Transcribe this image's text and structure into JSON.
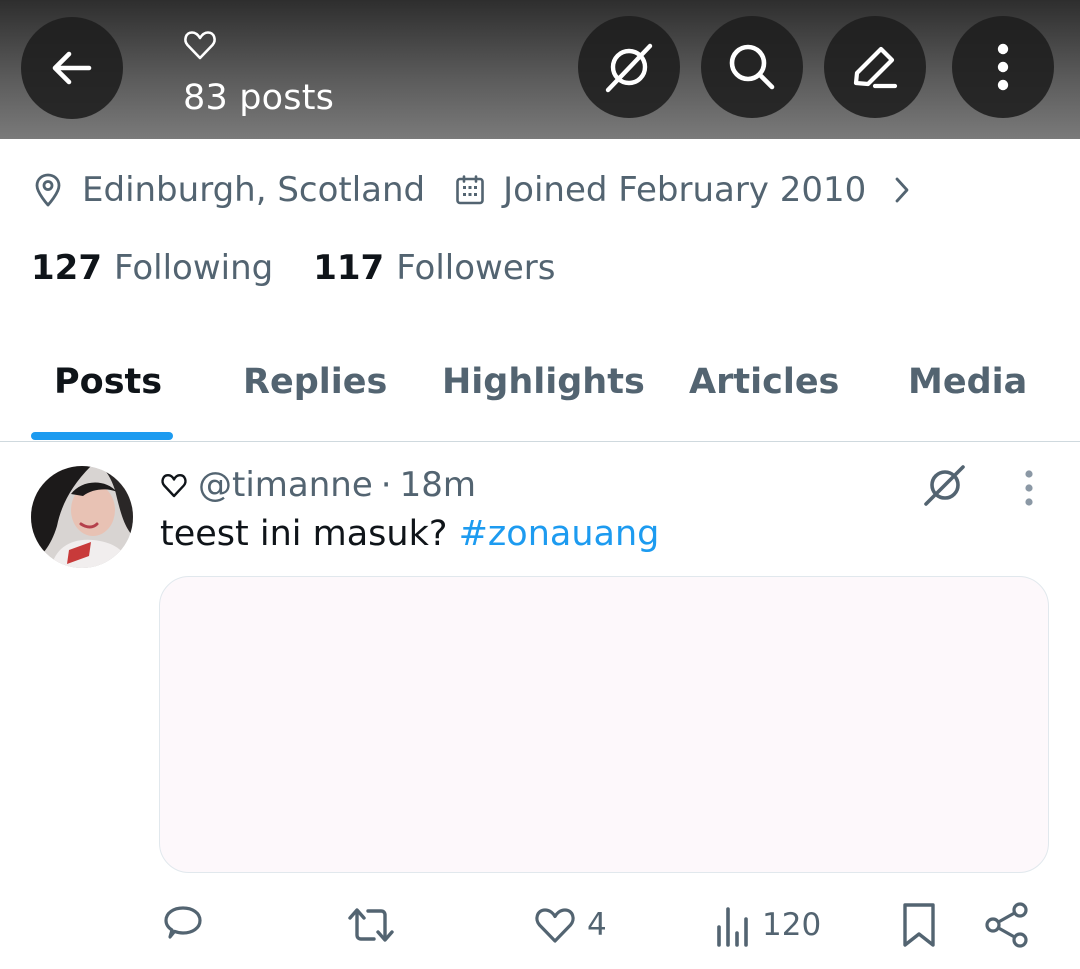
{
  "header": {
    "posts_count": "83 posts",
    "icons": {
      "back": "arrow-left-icon",
      "grok": "grok-icon",
      "search": "search-icon",
      "edit": "pencil-icon",
      "more": "more-vertical-icon",
      "name": "heart-outline-icon"
    }
  },
  "profile": {
    "location": "Edinburgh, Scotland",
    "joined": "Joined February 2010",
    "following_count": "127",
    "following_label": "Following",
    "followers_count": "117",
    "followers_label": "Followers"
  },
  "tabs": [
    {
      "label": "Posts",
      "active": true
    },
    {
      "label": "Replies",
      "active": false
    },
    {
      "label": "Highlights",
      "active": false
    },
    {
      "label": "Articles",
      "active": false
    },
    {
      "label": "Media",
      "active": false
    }
  ],
  "post": {
    "handle": "@timanne",
    "separator": "·",
    "time": "18m",
    "text": "teest ini masuk?",
    "hashtag": "#zonauang",
    "actions": {
      "reply_count": "",
      "repost_count": "",
      "like_count": "4",
      "views_count": "120"
    }
  },
  "colors": {
    "accent": "#1d9bf0",
    "secondary_text": "#536471",
    "primary_text": "#0f1419",
    "media_bg": "#fdf8fb"
  }
}
